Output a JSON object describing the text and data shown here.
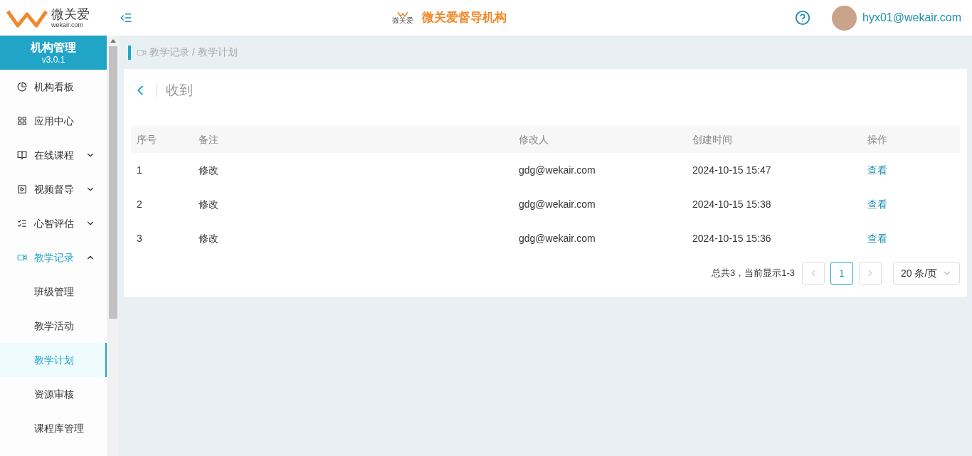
{
  "header": {
    "logo_text": "微关爱",
    "logo_domain": "wekair.com",
    "brand_small": "微关爱",
    "title": "微关爱督导机构",
    "user": "hyx01@wekair.com"
  },
  "sidebar": {
    "title": "机构管理",
    "version": "v3.0.1",
    "items": [
      {
        "label": "机构看板",
        "kind": "chart",
        "selected": false
      },
      {
        "label": "应用中心",
        "kind": "grid",
        "selected": false
      },
      {
        "label": "在线课程",
        "kind": "book",
        "selected": false,
        "expanded": false
      },
      {
        "label": "视频督导",
        "kind": "play",
        "selected": false,
        "expanded": false
      },
      {
        "label": "心智评估",
        "kind": "list",
        "selected": false,
        "expanded": false
      },
      {
        "label": "教学记录",
        "kind": "video",
        "selected": true,
        "expanded": true,
        "children": [
          {
            "label": "班级管理",
            "selected": false
          },
          {
            "label": "教学活动",
            "selected": false
          },
          {
            "label": "教学计划",
            "selected": true
          },
          {
            "label": "资源审核",
            "selected": false
          },
          {
            "label": "课程库管理",
            "selected": false
          }
        ]
      }
    ]
  },
  "breadcrumb": "教学记录 / 教学计划",
  "page_title": "收到",
  "table": {
    "columns": [
      "序号",
      "备注",
      "修改人",
      "创建时间",
      "操作"
    ],
    "rows": [
      [
        "1",
        "修改",
        "gdg@wekair.com",
        "2024-10-15 15:47",
        "查看"
      ],
      [
        "2",
        "修改",
        "gdg@wekair.com",
        "2024-10-15 15:38",
        "查看"
      ],
      [
        "3",
        "修改",
        "gdg@wekair.com",
        "2024-10-15 15:36",
        "查看"
      ]
    ]
  },
  "pagination": {
    "summary": "总共3，当前显示1-3",
    "pages": [
      {
        "label": "1",
        "selected": true
      }
    ],
    "page_size": "20 条/页"
  }
}
